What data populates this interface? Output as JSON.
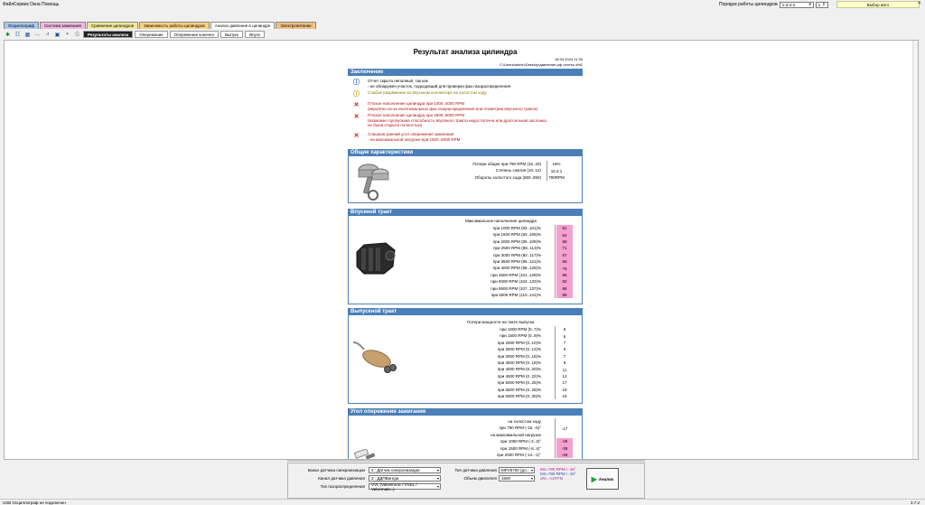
{
  "menu": [
    "Файл",
    "Сервис",
    "Окна",
    "Помощь"
  ],
  "cylinder_order": {
    "label": "Порядок работы цилиндров",
    "value": "1-3-4-2",
    "cyl": "1"
  },
  "device": "Выбор авто",
  "tabs": [
    {
      "label": "Осциллограф",
      "color": "#a8c8f0"
    },
    {
      "label": "Система зажигания",
      "color": "#f0b8e0"
    },
    {
      "label": "Сравнение цилиндров",
      "color": "#f0e898"
    },
    {
      "label": "Зависимость работы цилиндров",
      "color": "#f8d080"
    },
    {
      "label": "Анализ давления в цилиндре",
      "color": "#ffffff"
    },
    {
      "label": "Электропитание",
      "color": "#f0c080"
    }
  ],
  "subtabs": [
    "Результаты анализа",
    "Опережение",
    "Опережение конечно",
    "Выпуск",
    "Впуск"
  ],
  "report": {
    "title": "Результат анализа цилиндра",
    "date": "18.03.2024 11:39",
    "path": "C:\\Users\\admin\\Desktop\\давление-рф отчеты.dht2",
    "conclusion": {
      "header": "Заключение",
      "items": [
        {
          "type": "info",
          "lines": [
            "Отчет скрыта неполный, так как",
            " - не обнаружен участок, подходящий для проверки фаз газораспределения"
          ]
        },
        {
          "type": "warn",
          "lines": [
            "Слабое разряжение во впускном коллекторе на холостом ходу"
          ]
        },
        {
          "type": "error",
          "lines": [
            "Плохое наполнение цилиндра при 1000..4000 RPM",
            "(вероятно из-за неоптимальных фаз газораспределения или геометрии впускного тракта)"
          ]
        },
        {
          "type": "error",
          "lines": [
            "Плохое наполнение цилиндра при 4500..6000 RPM",
            "(возможно пропускная способность впускного тракта недостаточна или дроссельная заслонка",
            "не была открыта полностью)"
          ]
        },
        {
          "type": "error",
          "lines": [
            "Слишком ранний угол опережения зажигания",
            " - на максимальной нагрузке при 1000..6000 RPM"
          ]
        }
      ]
    },
    "general": {
      "header": "Общие характеристики",
      "rows": [
        {
          "label": "Потери общие при 790 RPM (15..20)",
          "value": "16%"
        },
        {
          "label": "Степень сжатия (10..12)",
          "value": "10.2:1"
        },
        {
          "label": "Обороты холостого хода (650..850)",
          "value": "790RPM"
        }
      ]
    },
    "intake": {
      "header": "Впускной тракт",
      "subtitle": "Максимальное наполнение цилиндра",
      "rows": [
        {
          "label": "при 1000 RPM (83..101)%",
          "value": "61"
        },
        {
          "label": "при 1500 RPM (83..105)%",
          "value": "64"
        },
        {
          "label": "при 2000 RPM (85..109)%",
          "value": "68"
        },
        {
          "label": "при 2500 RPM (88..113)%",
          "value": "71"
        },
        {
          "label": "при 3000 RPM (92..117)%",
          "value": "67"
        },
        {
          "label": "при 3500 RPM (95..121)%",
          "value": "69"
        },
        {
          "label": "при 4000 RPM (98..125)%",
          "value": "75"
        },
        {
          "label": "при 4500 RPM (101..129)%",
          "value": "86"
        },
        {
          "label": "при 5000 RPM (104..133)%",
          "value": "82"
        },
        {
          "label": "при 5500 RPM (107..137)%",
          "value": "86"
        },
        {
          "label": "при 6000 RPM (110..141)%",
          "value": "88"
        }
      ]
    },
    "exhaust": {
      "header": "Выпускной тракт",
      "subtitle": "Потери мощности на такте выпуска",
      "rows": [
        {
          "label": "при 1000 RPM (0..7)%",
          "value": "5"
        },
        {
          "label": "при 1500 RPM (0..9)%",
          "value": "6"
        },
        {
          "label": "при 2000 RPM (0..10)%",
          "value": "7"
        },
        {
          "label": "при 2500 RPM (0..12)%",
          "value": "6"
        },
        {
          "label": "при 3000 RPM (0..15)%",
          "value": "7"
        },
        {
          "label": "при 3500 RPM (0..18)%",
          "value": "9"
        },
        {
          "label": "при 4000 RPM (0..20)%",
          "value": "11"
        },
        {
          "label": "при 4500 RPM (0..22)%",
          "value": "13"
        },
        {
          "label": "при 5000 RPM (0..25)%",
          "value": "17"
        },
        {
          "label": "при 5500 RPM (0..28)%",
          "value": "18"
        },
        {
          "label": "при 6000 RPM (0..30)%",
          "value": "18"
        }
      ]
    },
    "ignition": {
      "header": "Угол опережения зажигания",
      "rows": [
        {
          "label": "на холостом ходу",
          "value": "",
          "pink": false
        },
        {
          "label": "при 790 RPM (-15..-5)°",
          "value": "-17",
          "pink": false
        },
        {
          "label": "на максимальной нагрузке",
          "value": "",
          "pink": false
        },
        {
          "label": "при 1000 RPM (-2..3)°",
          "value": "-28",
          "pink": true
        },
        {
          "label": "при 1500 RPM (-8..4)°",
          "value": "-39",
          "pink": true
        },
        {
          "label": "при 2000 RPM (-14..-1)°",
          "value": "-49",
          "pink": true
        }
      ]
    }
  },
  "bottom": {
    "sync_channel_label": "Канал датчика синхронизации",
    "sync_channel_value": "4 : Датчик синхронизации",
    "pressure_channel_label": "Канал датчика давления",
    "pressure_channel_value": "3 : ДДПВигнда",
    "timing_type_label": "Тип газораспределения",
    "timing_type_value": "VVL (Valvetronic / VVEL / Valvematic..)",
    "sensor_type_label": "Тип датчика давления",
    "sensor_type_value": "MPV5700 (дл...",
    "displacement_label": "Объем двигателя",
    "displacement_value": "1600",
    "rpm_lines": [
      "M1=790 RPM / -15°",
      "M2=790 RPM / -15°",
      "dM=-41RPM"
    ],
    "analyze_label": "Анализ"
  },
  "status": {
    "left": "USB Осциллограф не подключен",
    "right": "3.7.2"
  }
}
